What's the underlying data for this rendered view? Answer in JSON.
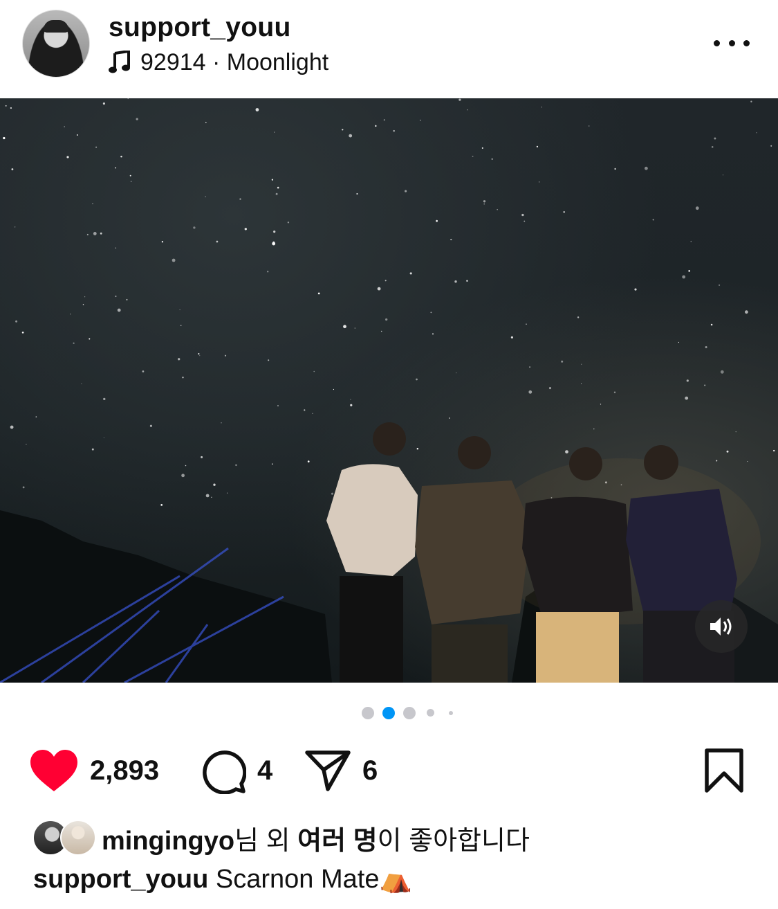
{
  "post": {
    "username": "support_youu",
    "music_label": "92914 · Moonlight",
    "media": {
      "carousel_total": 5,
      "carousel_active": 2
    },
    "actions": {
      "likes": "2,893",
      "comments": "4",
      "shares": "6"
    },
    "liked_by": {
      "user": "mingingyo",
      "suffix_1": "님 외 ",
      "bold_text": "여러 명",
      "suffix_2": "이 좋아합니다"
    },
    "caption": {
      "username": "support_youu",
      "text": " Scarnon Mate⛺"
    }
  },
  "colors": {
    "heart": "#ff0033",
    "active_dot": "#0095f6",
    "inactive_dot": "#c7c7cc"
  },
  "icons": [
    "music-note-icon",
    "more-icon",
    "volume-icon",
    "heart-icon",
    "comment-icon",
    "share-icon",
    "bookmark-icon"
  ]
}
